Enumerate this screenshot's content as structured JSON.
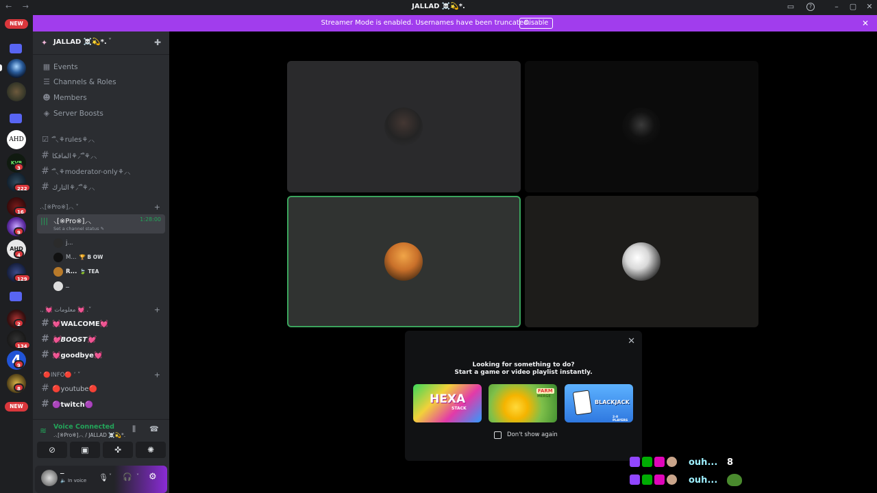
{
  "window": {
    "title": "JALLAD ☠️💫*.",
    "nav": "← →"
  },
  "banner": {
    "text": "Streamer Mode is enabled. Usernames have been truncated.",
    "disable_label": "Disable",
    "close": "✕"
  },
  "rail": {
    "new_top": "NEW",
    "new_bottom": "NEW",
    "ahd_label": "AHD",
    "badges": [
      "3",
      "222",
      "16",
      "9",
      "4",
      "129",
      "2",
      "134",
      "9",
      "8"
    ]
  },
  "server": {
    "name": "JALLAD ☠️💫*.",
    "chevron": "˅"
  },
  "menu": [
    {
      "label": "Events",
      "icon": "calendar-icon"
    },
    {
      "label": "Channels & Roles",
      "icon": "list-icon"
    },
    {
      "label": "Members",
      "icon": "members-icon"
    },
    {
      "label": "Server Boosts",
      "icon": "boost-icon"
    }
  ],
  "channels_top": [
    {
      "name": "࢑⸜⚘rules⚘⸝⸜"
    },
    {
      "name": "࢑⸜⚘المافكا⚘⸝⸜"
    },
    {
      "name": "࢑⸜⚘moderator-only⚘⸝⸜"
    },
    {
      "name": "࢑⸜⚘التارك⚘⸝⸜"
    }
  ],
  "voice_category": {
    "label": ".⸜[※Pro※]⸝⸜ ˅",
    "plus": "+"
  },
  "voice_channel": {
    "name": "⸜[※Pro※]⸝⸜",
    "timer": "1:28:00",
    "status": "Set a channel status ✎"
  },
  "voice_users": [
    {
      "name": "j...",
      "tag": ""
    },
    {
      "name": "M...",
      "tag": "🏆 B OW"
    },
    {
      "name": "R...",
      "tag": "🍃 TEA"
    },
    {
      "name": "ــ",
      "tag": ""
    }
  ],
  "hearts_category": {
    "label": "., 💓 معلومات 💓 .˅",
    "plus": "+"
  },
  "hearts_channels": [
    {
      "name": "💓WALCOME💓"
    },
    {
      "name": "💓BOOST💓"
    },
    {
      "name": "💓goodbye💓"
    }
  ],
  "info_category": {
    "label": "ʼ 🔴INFO🔴 ʼ ˅",
    "plus": "+"
  },
  "info_channels": [
    {
      "name": "🔴youtube🔴"
    },
    {
      "name": "🟣twitch🟣"
    }
  ],
  "rtc": {
    "status": "Voice Connected",
    "channel": ".⸜[※Pro※]⸝⸜ / JALLAD ☠️💫*."
  },
  "user": {
    "name": "ــ",
    "status": "🔈 In voice"
  },
  "activity_popup": {
    "title": "Looking for something to do?",
    "subtitle": "Start a game or video playlist instantly.",
    "close": "✕",
    "games": [
      {
        "name": "HEXA",
        "sub": "STACK"
      },
      {
        "name": "FARM",
        "sub": "MERGE"
      },
      {
        "name": "BLACKJACK",
        "sub": "2-8 PLAYERS"
      }
    ],
    "checkbox_label": "Don't show again"
  },
  "chat_overlay": [
    {
      "text": "ouh...",
      "extra": "8"
    },
    {
      "text": "ouh...",
      "extra": ""
    }
  ],
  "colors": {
    "accent": "#a13ded",
    "speaking_border": "#3ba55d",
    "rtc_green": "#23a55a",
    "badge_red": "#da373c"
  }
}
